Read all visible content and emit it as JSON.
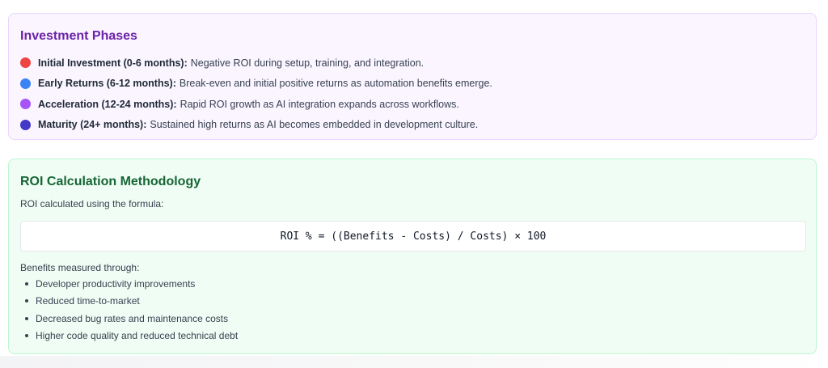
{
  "phases_card": {
    "title": "Investment Phases",
    "items": [
      {
        "name": "Initial Investment (0-6 months):",
        "description": "Negative ROI during setup, training, and integration.",
        "color": "#ef4444"
      },
      {
        "name": "Early Returns (6-12 months):",
        "description": "Break-even and initial positive returns as automation benefits emerge.",
        "color": "#3b82f6"
      },
      {
        "name": "Acceleration (12-24 months):",
        "description": "Rapid ROI growth as AI integration expands across workflows.",
        "color": "#a855f7"
      },
      {
        "name": "Maturity (24+ months):",
        "description": "Sustained high returns as AI becomes embedded in development culture.",
        "color": "#4338ca"
      }
    ]
  },
  "roi_card": {
    "title": "ROI Calculation Methodology",
    "intro": "ROI calculated using the formula:",
    "formula": "ROI % = ((Benefits - Costs) / Costs) × 100",
    "benefits_heading": "Benefits measured through:",
    "benefits": [
      "Developer productivity improvements",
      "Reduced time-to-market",
      "Decreased bug rates and maintenance costs",
      "Higher code quality and reduced technical debt"
    ]
  }
}
